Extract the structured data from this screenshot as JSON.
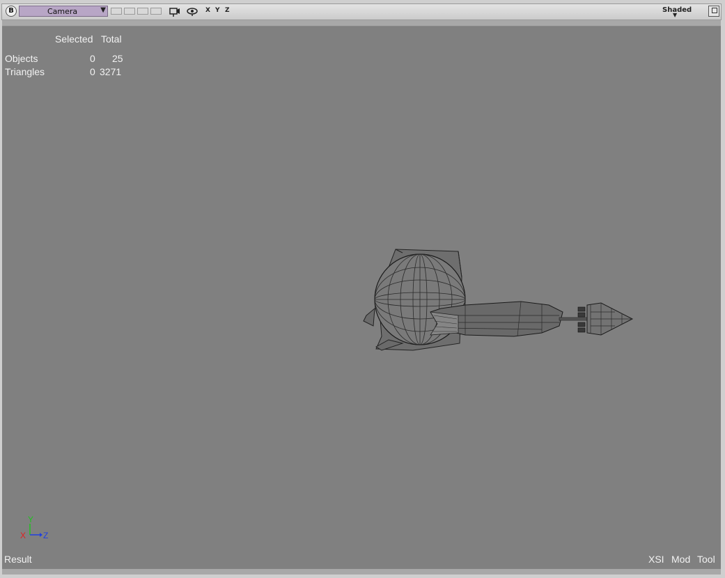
{
  "toolbar": {
    "b_button": "B",
    "camera_label": "Camera",
    "camera_arrow": "▼",
    "axis_x": "X",
    "axis_y": "Y",
    "axis_z": "Z",
    "display_mode": "Shaded"
  },
  "stats": {
    "header_selected": "Selected",
    "header_total": "Total",
    "rows": [
      {
        "label": "Objects",
        "selected": "0",
        "total": "25"
      },
      {
        "label": "Triangles",
        "selected": "0",
        "total": "3271"
      }
    ]
  },
  "axis_gizmo": {
    "y": "Y",
    "x": "X",
    "z": "Z",
    "colors": {
      "x": "#e02020",
      "y": "#20c020",
      "z": "#2040e0"
    }
  },
  "footer": {
    "left": "Result",
    "right_items": [
      "XSI",
      "Mod",
      "Tool"
    ]
  }
}
